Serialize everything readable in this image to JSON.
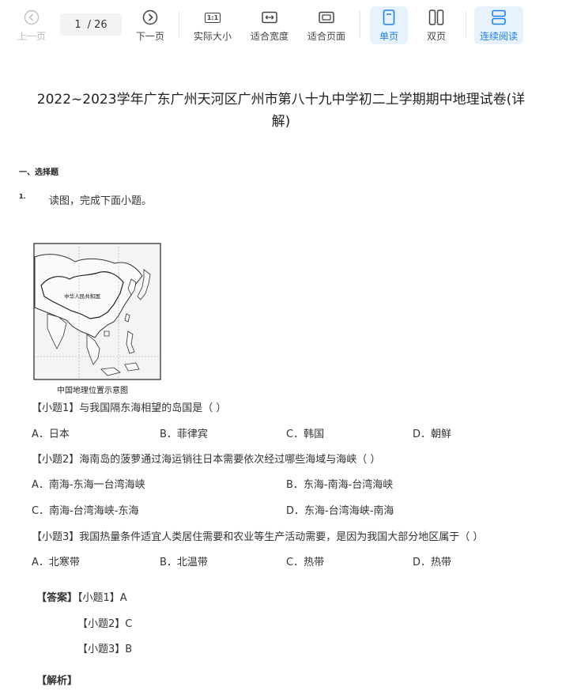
{
  "toolbar": {
    "prev_label": "上一页",
    "page_current": "1",
    "page_total": "/ 26",
    "next_label": "下一页",
    "actual_size_label": "实际大小",
    "actual_size_icon_text": "1:1",
    "fit_width_label": "适合宽度",
    "fit_page_label": "适合页面",
    "single_page_label": "单页",
    "double_page_label": "双页",
    "continuous_label": "连续阅读",
    "accent_color": "#1e80e8"
  },
  "document": {
    "title_line1": "2022~2023学年广东广州天河区广州市第八十九中学初二上学期期中地理试卷(详",
    "title_line2": "解)",
    "section": "一、选择题",
    "question_number": "1.",
    "question_stem": "读图，完成下面小题。",
    "map": {
      "caption": "中国地理位置示意图",
      "inner_label": "中华人民共和国"
    },
    "sub1": {
      "text": "【小题1】与我国隔东海相望的岛国是（     ）",
      "options": [
        "A．日本",
        "B．菲律宾",
        "C．韩国",
        "D．朝鲜"
      ]
    },
    "sub2": {
      "text": "【小题2】海南岛的菠萝通过海运销往日本需要依次经过哪些海域与海峡（     ）",
      "options": [
        "A．南海-东海一台湾海峡",
        "B．东海-南海-台湾海峡",
        "C．南海-台湾海峡-东海",
        "D．东海-台湾海峡-南海"
      ]
    },
    "sub3": {
      "text": "【小题3】我国热量条件适宜人类居住需要和农业等生产活动需要，是因为我国大部分地区属于（     ）",
      "options": [
        "A．北寒带",
        "B．北温带",
        "C．热带",
        "D．热带"
      ]
    },
    "answer": {
      "label": "【答案】",
      "line1": "【小题1】A",
      "line2": "【小题2】C",
      "line3": "【小题3】B"
    },
    "analysis_label": "【解析】"
  }
}
